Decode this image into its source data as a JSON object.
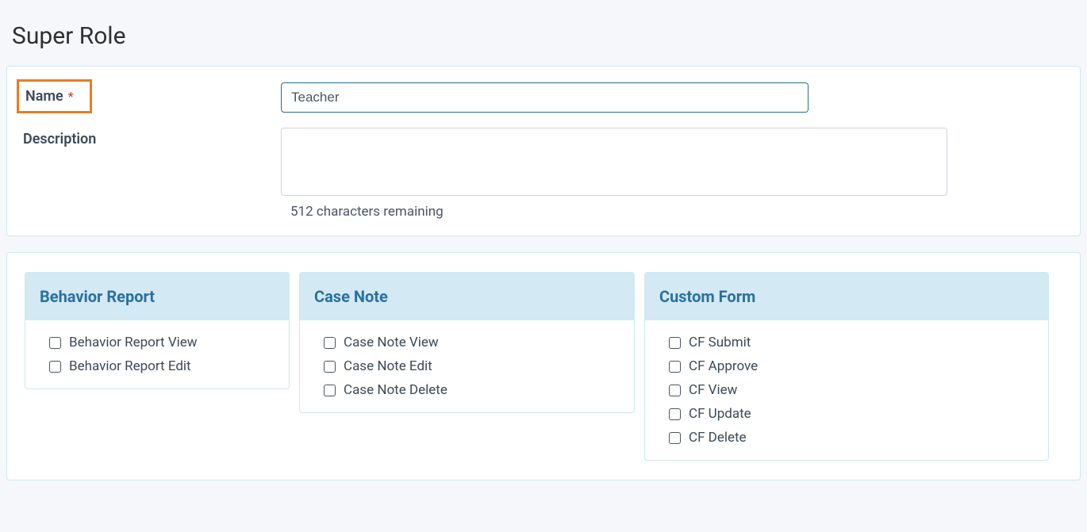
{
  "page_title": "Super Role",
  "form": {
    "name_label": "Name",
    "name_value": "Teacher",
    "description_label": "Description",
    "description_value": "",
    "char_remaining": "512 characters remaining"
  },
  "permission_groups": [
    {
      "title": "Behavior Report",
      "items": [
        {
          "label": "Behavior Report View",
          "checked": false
        },
        {
          "label": "Behavior Report Edit",
          "checked": false
        }
      ]
    },
    {
      "title": "Case Note",
      "items": [
        {
          "label": "Case Note View",
          "checked": false
        },
        {
          "label": "Case Note Edit",
          "checked": false
        },
        {
          "label": "Case Note Delete",
          "checked": false
        }
      ]
    },
    {
      "title": "Custom Form",
      "items": [
        {
          "label": "CF Submit",
          "checked": false
        },
        {
          "label": "CF Approve",
          "checked": false
        },
        {
          "label": "CF View",
          "checked": false
        },
        {
          "label": "CF Update",
          "checked": false
        },
        {
          "label": "CF Delete",
          "checked": false
        }
      ]
    }
  ]
}
